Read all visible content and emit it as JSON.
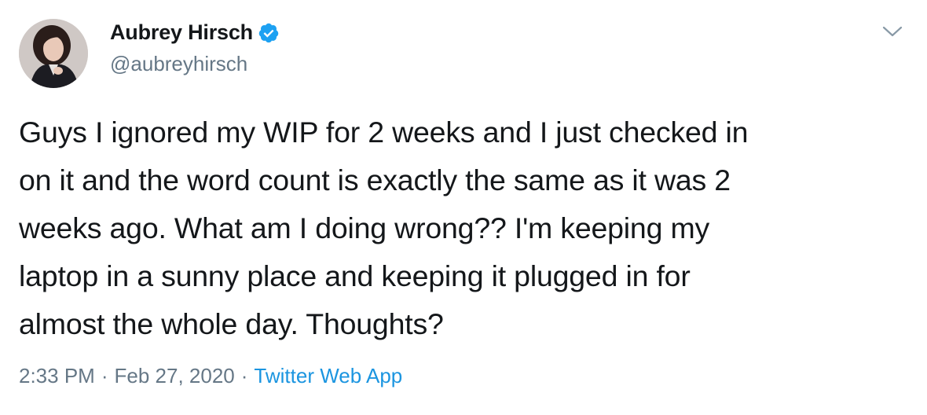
{
  "author": {
    "display_name": "Aubrey Hirsch",
    "handle": "@aubreyhirsch",
    "verified": true
  },
  "tweet": {
    "text": "Guys I ignored my WIP for 2 weeks and I just checked in\non it and the word count is exactly the same as it was 2\nweeks ago. What am I doing wrong?? I'm keeping my\nlaptop in a sunny place and keeping it plugged in for\nalmost the whole day. Thoughts?",
    "time": "2:33 PM",
    "separator": "·",
    "date": "Feb 27, 2020",
    "source": "Twitter Web App"
  },
  "icons": {
    "verified": "verified-badge-icon",
    "menu": "chevron-down-icon"
  },
  "colors": {
    "text": "#14171a",
    "secondary": "#657786",
    "link": "#1b95e0",
    "verified": "#1da1f2"
  }
}
